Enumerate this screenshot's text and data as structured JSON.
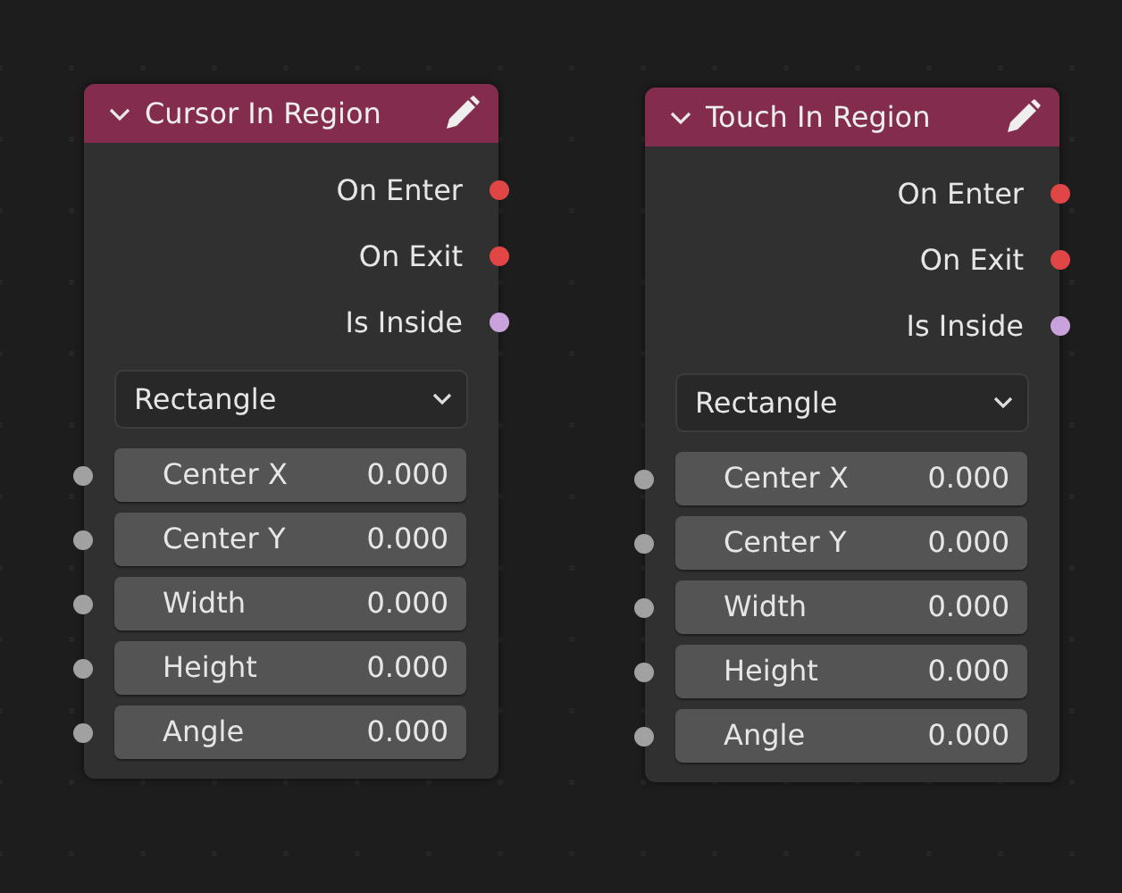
{
  "nodes": [
    {
      "title": "Cursor In Region",
      "expanded": true,
      "outputs": [
        {
          "label": "On Enter",
          "color": "#e04646"
        },
        {
          "label": "On Exit",
          "color": "#e04646"
        },
        {
          "label": "Is Inside",
          "color": "#c9a2dc"
        }
      ],
      "dropdown": {
        "value": "Rectangle"
      },
      "inputs": [
        {
          "label": "Center X",
          "value": "0.000",
          "color": "#a1a1a1"
        },
        {
          "label": "Center Y",
          "value": "0.000",
          "color": "#a1a1a1"
        },
        {
          "label": "Width",
          "value": "0.000",
          "color": "#a1a1a1"
        },
        {
          "label": "Height",
          "value": "0.000",
          "color": "#a1a1a1"
        },
        {
          "label": "Angle",
          "value": "0.000",
          "color": "#a1a1a1"
        }
      ]
    },
    {
      "title": "Touch In Region",
      "expanded": true,
      "outputs": [
        {
          "label": "On Enter",
          "color": "#e04646"
        },
        {
          "label": "On Exit",
          "color": "#e04646"
        },
        {
          "label": "Is Inside",
          "color": "#c9a2dc"
        }
      ],
      "dropdown": {
        "value": "Rectangle"
      },
      "inputs": [
        {
          "label": "Center X",
          "value": "0.000",
          "color": "#a1a1a1"
        },
        {
          "label": "Center Y",
          "value": "0.000",
          "color": "#a1a1a1"
        },
        {
          "label": "Width",
          "value": "0.000",
          "color": "#a1a1a1"
        },
        {
          "label": "Height",
          "value": "0.000",
          "color": "#a1a1a1"
        },
        {
          "label": "Angle",
          "value": "0.000",
          "color": "#a1a1a1"
        }
      ]
    }
  ]
}
